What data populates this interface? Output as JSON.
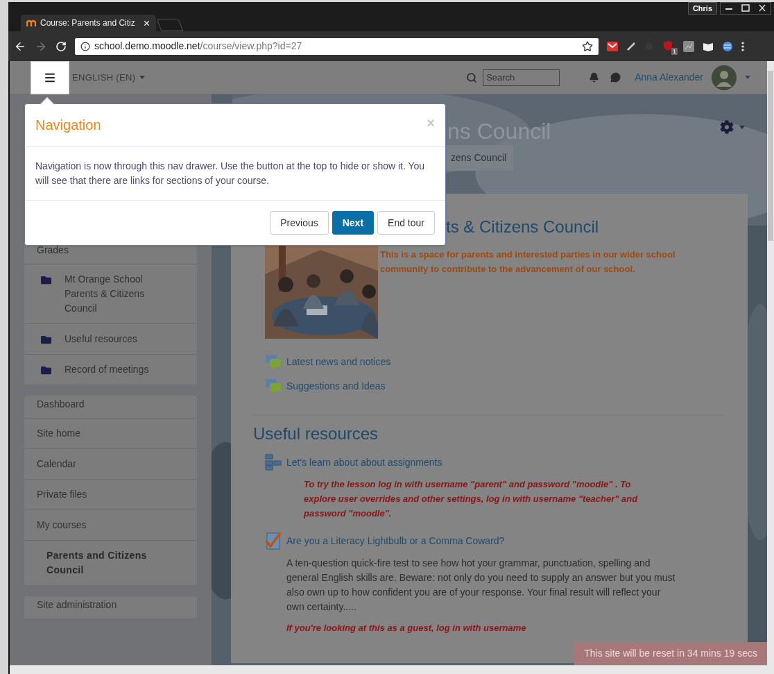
{
  "browser": {
    "tab_title": "Course: Parents and Citiz",
    "profile": "Chris",
    "url_host": "school.demo.moodle.net",
    "url_path": "/course/view.php?id=27",
    "extension_badge": "1"
  },
  "navbar": {
    "language": "ENGLISH (EN)",
    "search_placeholder": "Search",
    "user_name": "Anna Alexander"
  },
  "tour": {
    "title": "Navigation",
    "close": "×",
    "body": "Navigation is now through this nav drawer. Use the button at the top to hide or show it. You will see that there are links for sections of your course.",
    "buttons": [
      {
        "label": "Previous",
        "primary": false
      },
      {
        "label": "Next",
        "primary": true
      },
      {
        "label": "End tour",
        "primary": false
      }
    ]
  },
  "drawer": {
    "groups": [
      {
        "items": [
          {
            "label": "Grades",
            "kind": "plain"
          },
          {
            "label": "Mt Orange School Parents & Citizens Council",
            "kind": "section"
          },
          {
            "label": "Useful resources",
            "kind": "section"
          },
          {
            "label": "Record of meetings",
            "kind": "section"
          }
        ]
      },
      {
        "items": [
          {
            "label": "Dashboard",
            "kind": "plain"
          },
          {
            "label": "Site home",
            "kind": "plain"
          },
          {
            "label": "Calendar",
            "kind": "plain"
          },
          {
            "label": "Private files",
            "kind": "plain"
          },
          {
            "label": "My courses",
            "kind": "plain"
          },
          {
            "label": "Parents and Citizens Council",
            "kind": "course"
          }
        ]
      },
      {
        "items": [
          {
            "label": "Site administration",
            "kind": "plain"
          }
        ]
      }
    ]
  },
  "page_header": {
    "title": "ns Council",
    "breadcrumb": "zens Council"
  },
  "sections": [
    {
      "title": "ts & Citizens Council",
      "summary": "This is a space for parents and interested parties in our wider school community to contribute to the advancement of our school.",
      "activities": [
        {
          "kind": "forum",
          "name": "Latest news and notices"
        },
        {
          "kind": "forum",
          "name": "Suggestions and Ideas"
        }
      ]
    },
    {
      "title": "Useful resources",
      "activities": [
        {
          "kind": "lesson",
          "name": "Let's learn about about assignments",
          "notes": [
            {
              "kind": "warning",
              "text": "To try the lesson log in with username \"parent\" and password \"moodle\" . To explore user overrides and other settings, log in with username \"teacher\" and password \"moodle\"."
            }
          ]
        },
        {
          "kind": "quiz",
          "name": "Are you a Literacy Lightbulb or a Comma Coward?",
          "notes": [
            {
              "kind": "plain",
              "text": "A ten-question quick-fire test to see how hot your grammar, punctuation, spelling and general English skills are. Beware: not only do you need to supply an answer but you must also own up to how confident you are of your response. Your final result will reflect your own certainty....."
            },
            {
              "kind": "warning",
              "text": "If you're looking at this as a guest, log in with username"
            }
          ]
        }
      ]
    }
  ],
  "reset_notice": "This site will be reset in 34 mins 19 secs"
}
